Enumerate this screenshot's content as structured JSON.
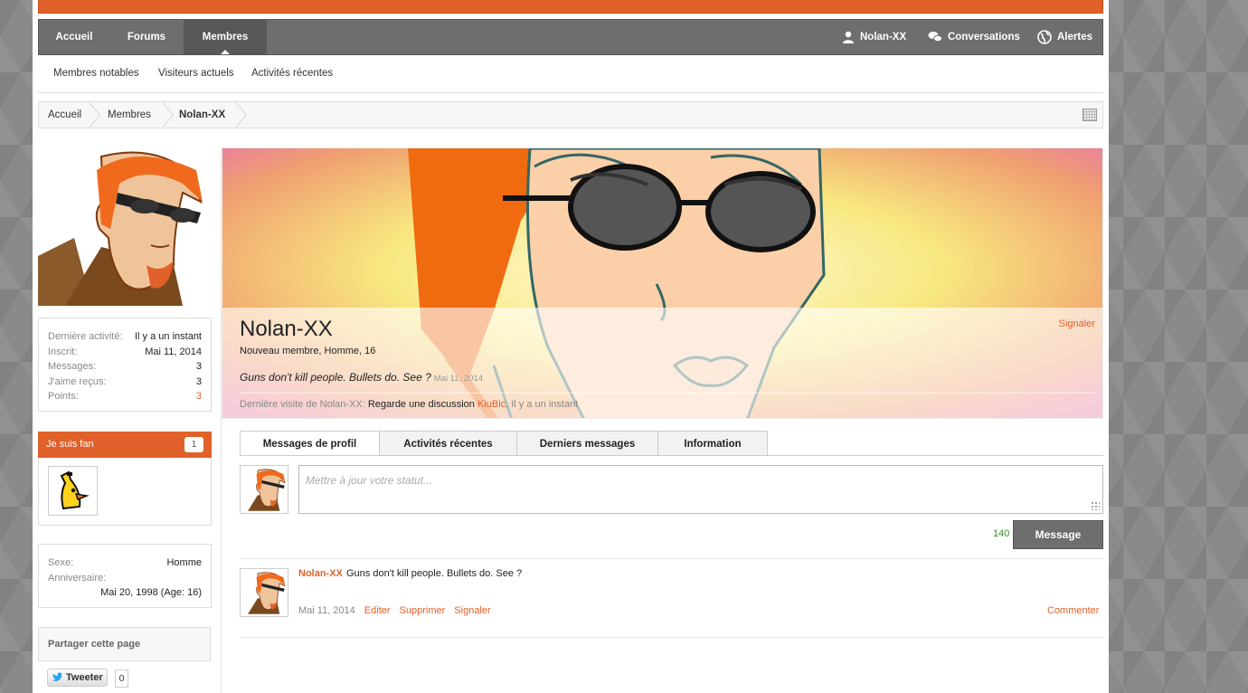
{
  "nav": {
    "tabs": [
      "Accueil",
      "Forums",
      "Membres"
    ],
    "user": "Nolan-XX",
    "conversations": "Conversations",
    "alerts": "Alertes"
  },
  "subnav": [
    "Membres notables",
    "Visiteurs actuels",
    "Activités récentes"
  ],
  "breadcrumb": [
    "Accueil",
    "Membres",
    "Nolan-XX"
  ],
  "stats": [
    {
      "label": "Dernière activité:",
      "value": "Il y a un instant"
    },
    {
      "label": "Inscrit:",
      "value": "Mai 11, 2014"
    },
    {
      "label": "Messages:",
      "value": "3"
    },
    {
      "label": "J'aime reçus:",
      "value": "3"
    },
    {
      "label": "Points:",
      "value": "3"
    }
  ],
  "fans": {
    "title": "Je suis fan",
    "count": "1"
  },
  "info": {
    "gender_label": "Sexe:",
    "gender": "Homme",
    "birthday_label": "Anniversaire:",
    "birthday": "Mai 20, 1998 (Age: 16)"
  },
  "share": {
    "title": "Partager cette page",
    "tweet": "Tweeter",
    "tweet_count": "0"
  },
  "profile": {
    "name": "Nolan-XX",
    "subtitle": "Nouveau membre, Homme, 16",
    "status": "Guns don't kill people. Bullets do. See ?",
    "status_date": "Mai 11, 2014",
    "report": "Signaler",
    "last_seen_prefix": "Dernière visite de Nolan-XX:",
    "last_seen_action": "Regarde une discussion",
    "last_seen_thread": "KiuBic",
    "last_seen_time": ", Il y a un instant"
  },
  "tabs": [
    "Messages de profil",
    "Activités récentes",
    "Derniers messages",
    "Information"
  ],
  "composer": {
    "placeholder": "Mettre à jour votre statut...",
    "remaining": "140",
    "submit": "Message"
  },
  "post": {
    "author": "Nolan-XX",
    "text": "Guns don't kill people. Bullets do. See ?",
    "date": "Mai 11, 2014",
    "edit": "Editer",
    "delete": "Supprimer",
    "report": "Signaler",
    "comment": "Commenter"
  },
  "colors": {
    "accent": "#e0612a",
    "navbar": "#6e6e6e",
    "count_green": "#3a8a2a"
  }
}
